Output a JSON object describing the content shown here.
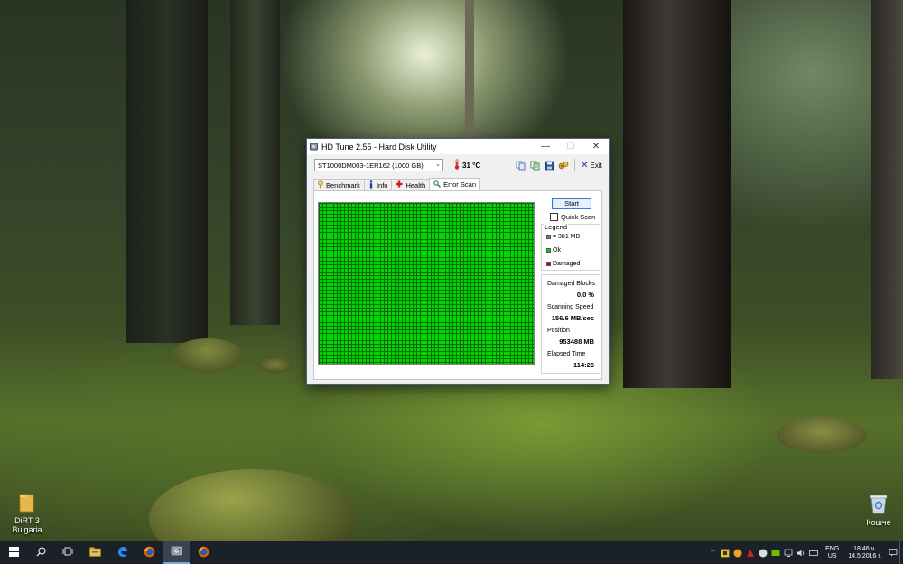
{
  "window": {
    "title": "HD Tune 2.55 - Hard Disk Utility",
    "minimize": "—",
    "maximize": "☐",
    "close": "✕"
  },
  "toolbar": {
    "drive": "ST1000DM003-1ER162 (1000 GB)",
    "temperature": "31 °C",
    "exit_label": "Exit",
    "icons": [
      "copy-icon",
      "copy-text-icon",
      "save-icon",
      "options-icon"
    ]
  },
  "tabs": [
    {
      "label": "Benchmark",
      "icon": "benchmark-icon"
    },
    {
      "label": "Info",
      "icon": "info-icon"
    },
    {
      "label": "Health",
      "icon": "health-icon"
    },
    {
      "label": "Error Scan",
      "icon": "magnifier-icon",
      "active": true
    }
  ],
  "scan": {
    "start_label": "Start",
    "quick_scan_label": "Quick Scan",
    "quick_scan_checked": false,
    "block_color": "#00d800",
    "legend": {
      "title": "Legend",
      "block_size": "= 381 MB",
      "ok": "Ok",
      "damaged": "Damaged",
      "ok_color": "#00d800",
      "damaged_color": "#c80000",
      "block_color_gray": "#808080"
    },
    "stats": {
      "damaged_blocks_label": "Damaged Blocks",
      "damaged_blocks_value": "0.0 %",
      "scanning_speed_label": "Scanning Speed",
      "scanning_speed_value": "156.6 MB/sec",
      "position_label": "Position",
      "position_value": "953488 MB",
      "elapsed_label": "Elapsed Time",
      "elapsed_value": "114:25"
    }
  },
  "desktop": {
    "icons": [
      {
        "label": "DiRT 3 Bulgaria",
        "icon": "folder-icon"
      },
      {
        "label": "Кошче",
        "icon": "recycle-bin-icon"
      }
    ]
  },
  "taskbar": {
    "buttons": [
      "start-icon",
      "search-icon",
      "task-view-icon",
      "file-explorer-icon",
      "edge-icon",
      "firefox-icon",
      "hdtune-icon",
      "firefox-icon"
    ],
    "language_line1": "ENG",
    "language_line2": "US",
    "time": "18:46 ч.",
    "date": "14.5.2016 г.",
    "accent": "#1b2128"
  }
}
